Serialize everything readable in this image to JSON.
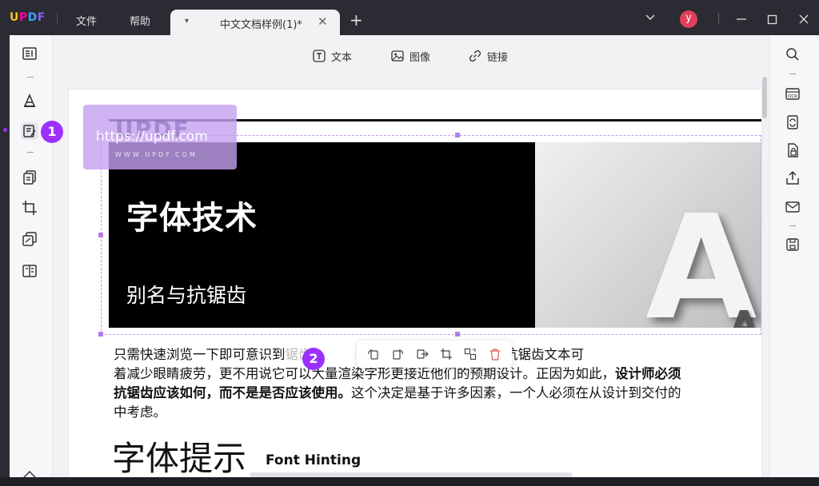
{
  "app": {
    "logo": "UPDF"
  },
  "menu": [
    {
      "label": "文件"
    },
    {
      "label": "帮助"
    }
  ],
  "tab": {
    "title": "中文文档样例(1)*"
  },
  "user": {
    "initial": "y",
    "color": "#e0405a"
  },
  "toolbar": {
    "text_label": "文本",
    "image_label": "图像",
    "link_label": "链接"
  },
  "document": {
    "banner_title": "字体技术",
    "banner_subtitle": "别名与抗锯齿",
    "paragraph_lines": [
      [
        "只需快速浏览一下即可意识到",
        "锯齿",
        "很重要。除了少数例外，抗锯齿文本可"
      ],
      [
        "着减少眼睛疲劳，更不用说它可以大量渲染字形更接近他们的预期设计。正因为如此，",
        "设计师必须"
      ],
      [
        "抗锯齿应该如何，而不是是否应该使用。",
        "这个决定是基于许多因素，一个人必须在从设计到交付的"
      ],
      [
        "中考虑。"
      ]
    ],
    "heading": "字体提示",
    "heading_en": "Font Hinting",
    "big_letter": "A",
    "small_letter": "A"
  },
  "watermark": {
    "logo": "UPDF",
    "url": "https://updf.com",
    "small_text": "WWW.UPDF.COM"
  },
  "badges": {
    "one": "1",
    "two": "2"
  },
  "colors": {
    "accent": "#9b30ff",
    "selection": "#c79cf0",
    "titlebar": "#2b2b33"
  }
}
